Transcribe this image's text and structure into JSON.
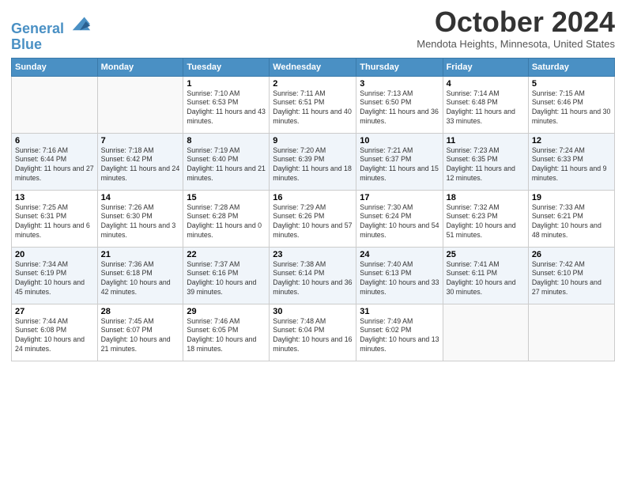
{
  "logo": {
    "line1": "General",
    "line2": "Blue"
  },
  "title": "October 2024",
  "location": "Mendota Heights, Minnesota, United States",
  "days_of_week": [
    "Sunday",
    "Monday",
    "Tuesday",
    "Wednesday",
    "Thursday",
    "Friday",
    "Saturday"
  ],
  "weeks": [
    [
      {
        "day": "",
        "info": ""
      },
      {
        "day": "",
        "info": ""
      },
      {
        "day": "1",
        "info": "Sunrise: 7:10 AM\nSunset: 6:53 PM\nDaylight: 11 hours and 43 minutes."
      },
      {
        "day": "2",
        "info": "Sunrise: 7:11 AM\nSunset: 6:51 PM\nDaylight: 11 hours and 40 minutes."
      },
      {
        "day": "3",
        "info": "Sunrise: 7:13 AM\nSunset: 6:50 PM\nDaylight: 11 hours and 36 minutes."
      },
      {
        "day": "4",
        "info": "Sunrise: 7:14 AM\nSunset: 6:48 PM\nDaylight: 11 hours and 33 minutes."
      },
      {
        "day": "5",
        "info": "Sunrise: 7:15 AM\nSunset: 6:46 PM\nDaylight: 11 hours and 30 minutes."
      }
    ],
    [
      {
        "day": "6",
        "info": "Sunrise: 7:16 AM\nSunset: 6:44 PM\nDaylight: 11 hours and 27 minutes."
      },
      {
        "day": "7",
        "info": "Sunrise: 7:18 AM\nSunset: 6:42 PM\nDaylight: 11 hours and 24 minutes."
      },
      {
        "day": "8",
        "info": "Sunrise: 7:19 AM\nSunset: 6:40 PM\nDaylight: 11 hours and 21 minutes."
      },
      {
        "day": "9",
        "info": "Sunrise: 7:20 AM\nSunset: 6:39 PM\nDaylight: 11 hours and 18 minutes."
      },
      {
        "day": "10",
        "info": "Sunrise: 7:21 AM\nSunset: 6:37 PM\nDaylight: 11 hours and 15 minutes."
      },
      {
        "day": "11",
        "info": "Sunrise: 7:23 AM\nSunset: 6:35 PM\nDaylight: 11 hours and 12 minutes."
      },
      {
        "day": "12",
        "info": "Sunrise: 7:24 AM\nSunset: 6:33 PM\nDaylight: 11 hours and 9 minutes."
      }
    ],
    [
      {
        "day": "13",
        "info": "Sunrise: 7:25 AM\nSunset: 6:31 PM\nDaylight: 11 hours and 6 minutes."
      },
      {
        "day": "14",
        "info": "Sunrise: 7:26 AM\nSunset: 6:30 PM\nDaylight: 11 hours and 3 minutes."
      },
      {
        "day": "15",
        "info": "Sunrise: 7:28 AM\nSunset: 6:28 PM\nDaylight: 11 hours and 0 minutes."
      },
      {
        "day": "16",
        "info": "Sunrise: 7:29 AM\nSunset: 6:26 PM\nDaylight: 10 hours and 57 minutes."
      },
      {
        "day": "17",
        "info": "Sunrise: 7:30 AM\nSunset: 6:24 PM\nDaylight: 10 hours and 54 minutes."
      },
      {
        "day": "18",
        "info": "Sunrise: 7:32 AM\nSunset: 6:23 PM\nDaylight: 10 hours and 51 minutes."
      },
      {
        "day": "19",
        "info": "Sunrise: 7:33 AM\nSunset: 6:21 PM\nDaylight: 10 hours and 48 minutes."
      }
    ],
    [
      {
        "day": "20",
        "info": "Sunrise: 7:34 AM\nSunset: 6:19 PM\nDaylight: 10 hours and 45 minutes."
      },
      {
        "day": "21",
        "info": "Sunrise: 7:36 AM\nSunset: 6:18 PM\nDaylight: 10 hours and 42 minutes."
      },
      {
        "day": "22",
        "info": "Sunrise: 7:37 AM\nSunset: 6:16 PM\nDaylight: 10 hours and 39 minutes."
      },
      {
        "day": "23",
        "info": "Sunrise: 7:38 AM\nSunset: 6:14 PM\nDaylight: 10 hours and 36 minutes."
      },
      {
        "day": "24",
        "info": "Sunrise: 7:40 AM\nSunset: 6:13 PM\nDaylight: 10 hours and 33 minutes."
      },
      {
        "day": "25",
        "info": "Sunrise: 7:41 AM\nSunset: 6:11 PM\nDaylight: 10 hours and 30 minutes."
      },
      {
        "day": "26",
        "info": "Sunrise: 7:42 AM\nSunset: 6:10 PM\nDaylight: 10 hours and 27 minutes."
      }
    ],
    [
      {
        "day": "27",
        "info": "Sunrise: 7:44 AM\nSunset: 6:08 PM\nDaylight: 10 hours and 24 minutes."
      },
      {
        "day": "28",
        "info": "Sunrise: 7:45 AM\nSunset: 6:07 PM\nDaylight: 10 hours and 21 minutes."
      },
      {
        "day": "29",
        "info": "Sunrise: 7:46 AM\nSunset: 6:05 PM\nDaylight: 10 hours and 18 minutes."
      },
      {
        "day": "30",
        "info": "Sunrise: 7:48 AM\nSunset: 6:04 PM\nDaylight: 10 hours and 16 minutes."
      },
      {
        "day": "31",
        "info": "Sunrise: 7:49 AM\nSunset: 6:02 PM\nDaylight: 10 hours and 13 minutes."
      },
      {
        "day": "",
        "info": ""
      },
      {
        "day": "",
        "info": ""
      }
    ]
  ]
}
